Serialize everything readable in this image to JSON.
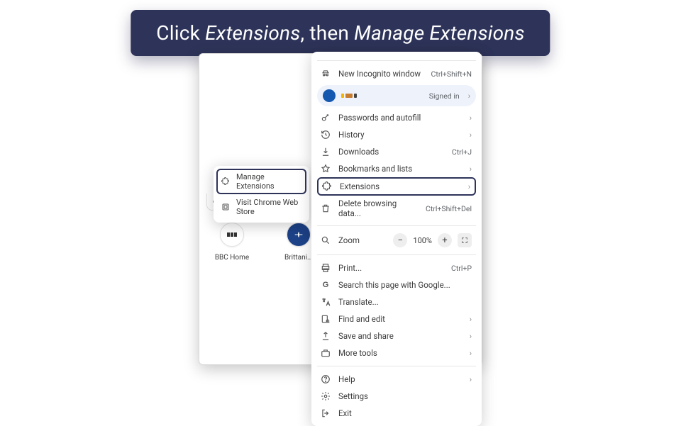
{
  "banner": {
    "part1": "Click ",
    "em1": "Extensions",
    "mid": ", then ",
    "em2": "Manage Extensions"
  },
  "menu": {
    "new_incognito": "New Incognito window",
    "new_incognito_shortcut": "Ctrl+Shift+N",
    "profile_status": "Signed in",
    "passwords": "Passwords and autofill",
    "history": "History",
    "downloads": "Downloads",
    "downloads_shortcut": "Ctrl+J",
    "bookmarks": "Bookmarks and lists",
    "extensions": "Extensions",
    "delete_data": "Delete browsing data...",
    "delete_data_shortcut": "Ctrl+Shift+Del",
    "zoom_label": "Zoom",
    "zoom_value": "100%",
    "print": "Print...",
    "print_shortcut": "Ctrl+P",
    "search_page": "Search this page with Google...",
    "translate": "Translate...",
    "find_edit": "Find and edit",
    "save_share": "Save and share",
    "more_tools": "More tools",
    "help": "Help",
    "settings": "Settings",
    "exit": "Exit"
  },
  "submenu": {
    "manage": "Manage Extensions",
    "webstore": "Visit Chrome Web Store"
  },
  "ntp": {
    "bbc": "BBC Home",
    "brit": "Brittani..."
  }
}
